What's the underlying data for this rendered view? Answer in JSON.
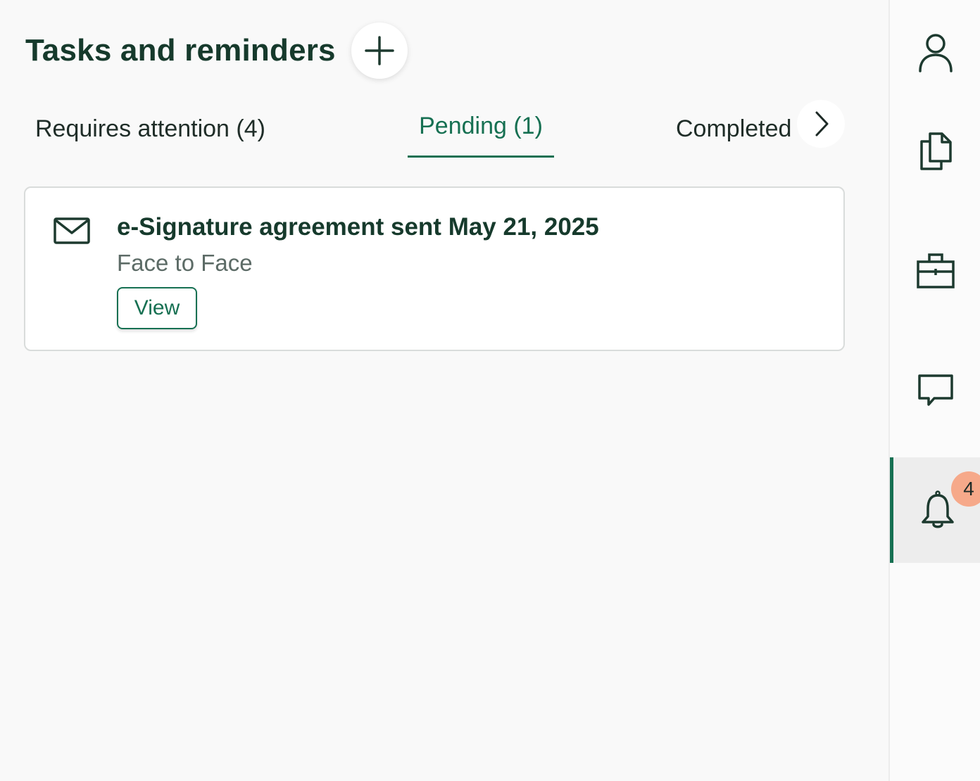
{
  "header": {
    "title": "Tasks and reminders",
    "add_icon": "plus-icon"
  },
  "tabs": [
    {
      "label": "Requires attention (4)",
      "active": false
    },
    {
      "label": "Pending (1)",
      "active": true
    },
    {
      "label": "Completed",
      "active": false
    }
  ],
  "tabs_next_icon": "chevron-right-icon",
  "task": {
    "icon": "envelope-icon",
    "title": "e-Signature agreement sent May 21, 2025",
    "subtitle": "Face to Face",
    "action_label": "View"
  },
  "rail": {
    "items": [
      {
        "icon": "person-icon"
      },
      {
        "icon": "documents-icon"
      },
      {
        "icon": "briefcase-icon"
      },
      {
        "icon": "chat-icon"
      },
      {
        "icon": "bell-icon",
        "active": true,
        "badge": "4"
      }
    ]
  },
  "colors": {
    "accent": "#167052",
    "title": "#163a2c",
    "badge": "#f6a98a",
    "background": "#f9f9f9"
  }
}
